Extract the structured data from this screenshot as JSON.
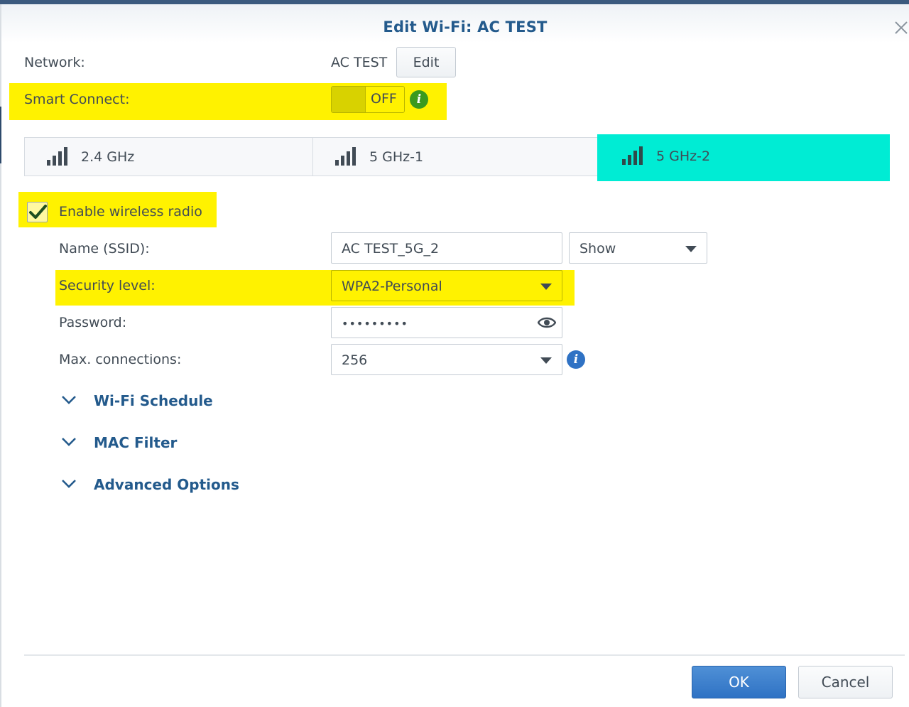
{
  "window": {
    "title": "Edit Wi-Fi: AC TEST"
  },
  "network": {
    "label": "Network:",
    "value": "AC TEST",
    "edit_label": "Edit"
  },
  "smart_connect": {
    "label": "Smart Connect:",
    "state": "OFF"
  },
  "tabs": [
    {
      "label": "2.4 GHz",
      "selected": false
    },
    {
      "label": "5 GHz-1",
      "selected": false
    },
    {
      "label": "5 GHz-2",
      "selected": true
    }
  ],
  "enable_radio": {
    "label": "Enable wireless radio",
    "checked": true
  },
  "fields": {
    "ssid": {
      "label": "Name (SSID):",
      "value": "AC TEST_5G_2",
      "visibility": "Show"
    },
    "security": {
      "label": "Security level:",
      "value": "WPA2-Personal"
    },
    "password": {
      "label": "Password:",
      "value": "•••••••••"
    },
    "max_connections": {
      "label": "Max. connections:",
      "value": "256"
    }
  },
  "sections": [
    {
      "label": "Wi-Fi Schedule"
    },
    {
      "label": "MAC Filter"
    },
    {
      "label": "Advanced Options"
    }
  ],
  "footer": {
    "ok_label": "OK",
    "cancel_label": "Cancel"
  },
  "colors": {
    "accent": "#235a8c",
    "highlight_yellow": "#fff200",
    "highlight_cyan": "#00ecd4",
    "info_green": "#3a9a1e",
    "info_blue": "#2f72c4"
  }
}
